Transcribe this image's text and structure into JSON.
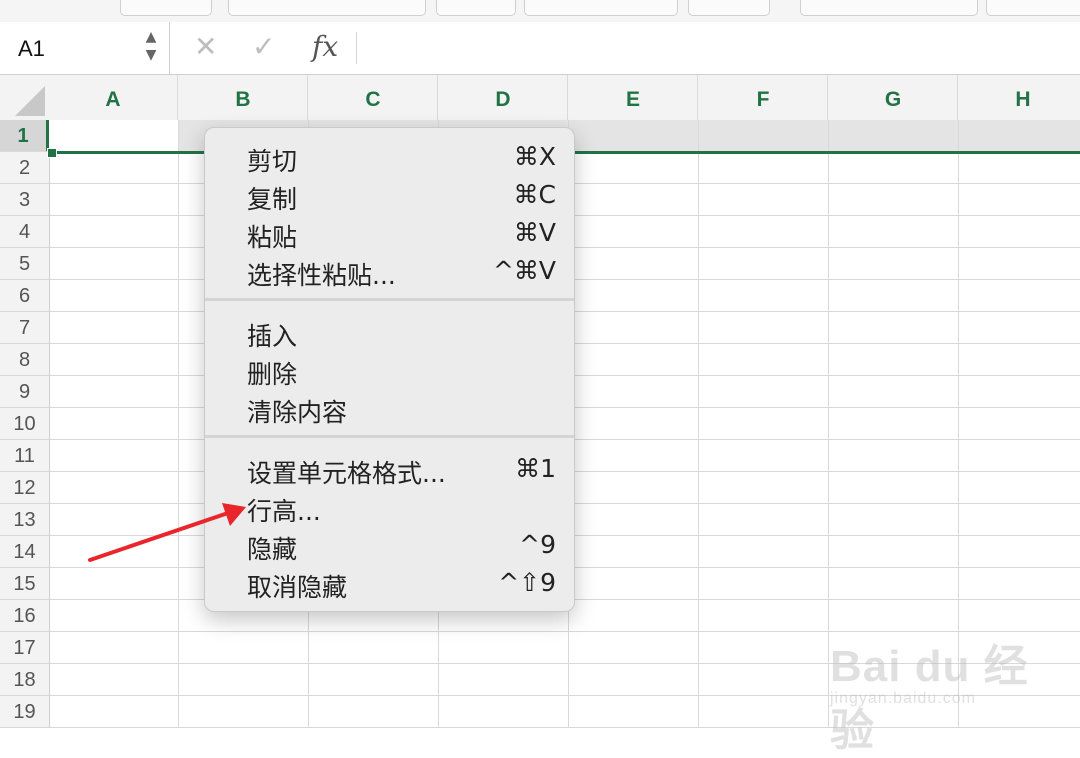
{
  "formula_bar": {
    "name_box": "A1",
    "cancel_glyph": "✕",
    "enter_glyph": "✓",
    "fx_glyph": "fx",
    "spinner_up": "▲",
    "spinner_down": "▼"
  },
  "columns": [
    "A",
    "B",
    "C",
    "D",
    "E",
    "F",
    "G",
    "H"
  ],
  "rows": [
    "1",
    "2",
    "3",
    "4",
    "5",
    "6",
    "7",
    "8",
    "9",
    "10",
    "11",
    "12",
    "13",
    "14",
    "15",
    "16",
    "17",
    "18",
    "19"
  ],
  "selection": {
    "row": "1",
    "cell": "A1",
    "accent_color": "#217346"
  },
  "context_menu": {
    "groups": [
      [
        {
          "label": "剪切",
          "shortcut": "⌘X"
        },
        {
          "label": "复制",
          "shortcut": "⌘C"
        },
        {
          "label": "粘贴",
          "shortcut": "⌘V"
        },
        {
          "label": "选择性粘贴...",
          "shortcut": "^⌘V"
        }
      ],
      [
        {
          "label": "插入",
          "shortcut": ""
        },
        {
          "label": "删除",
          "shortcut": ""
        },
        {
          "label": "清除内容",
          "shortcut": ""
        }
      ],
      [
        {
          "label": "设置单元格格式...",
          "shortcut": "⌘1"
        },
        {
          "label": "行高...",
          "shortcut": ""
        },
        {
          "label": "隐藏",
          "shortcut": "^9"
        },
        {
          "label": "取消隐藏",
          "shortcut": "^⇧9"
        }
      ]
    ]
  },
  "annotation": {
    "arrow_color": "#e8262b",
    "points_to": "行高..."
  },
  "watermark": {
    "logo": "Bai du 经验",
    "url": "jingyan.baidu.com"
  }
}
